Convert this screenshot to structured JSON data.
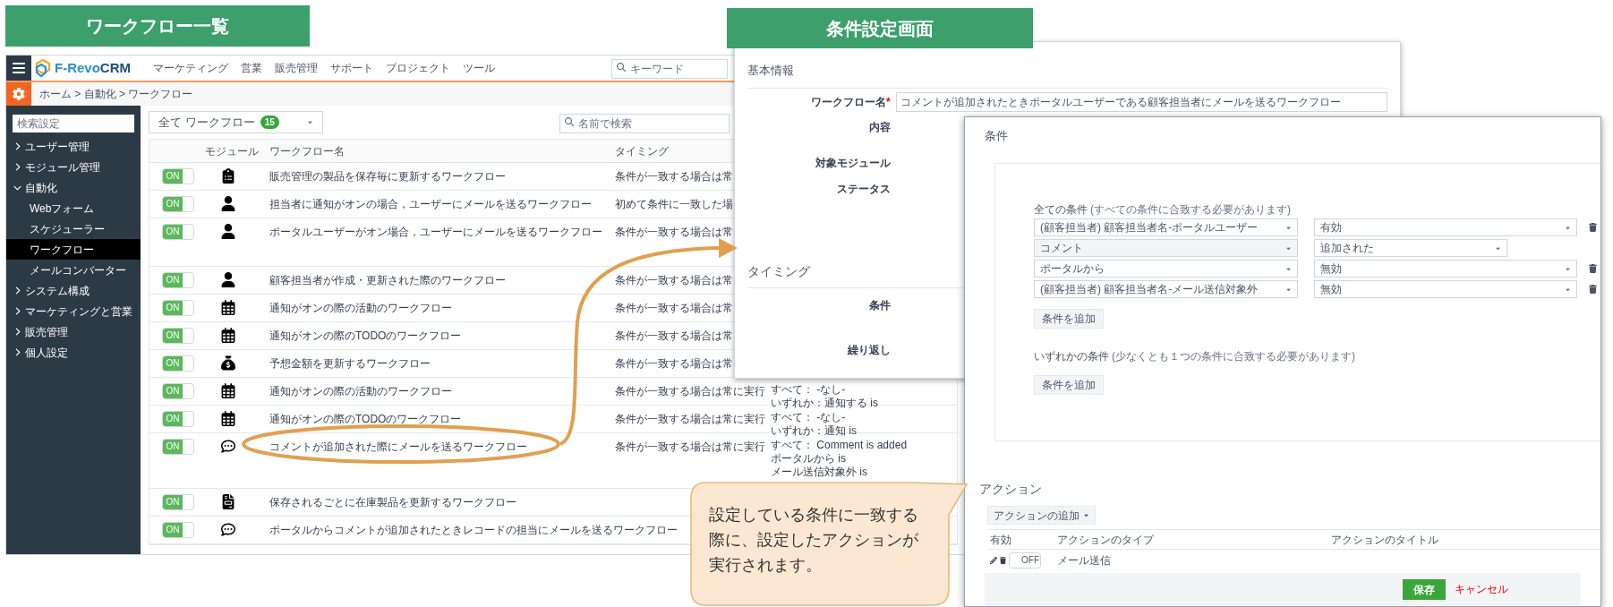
{
  "list_label": "ワークフロー一覧",
  "settings_label": "条件設定画面",
  "list_screen": {
    "logo": {
      "main": "F-Revo",
      "accent": "CRM"
    },
    "nav": [
      "マーケティング",
      "営業",
      "販売管理",
      "サポート",
      "プロジェクト",
      "ツール"
    ],
    "search": {
      "placeholder": "キーワード"
    },
    "breadcrumb": "ホーム > 自動化 > ワークフロー",
    "sidebar": {
      "search": {
        "placeholder": "検索設定"
      },
      "items": [
        {
          "label": "ユーザー管理",
          "expanded": false
        },
        {
          "label": "モジュール管理",
          "expanded": false
        },
        {
          "label": "自動化",
          "expanded": true,
          "children": [
            {
              "label": "Webフォーム",
              "selected": false
            },
            {
              "label": "スケジューラー",
              "selected": false
            },
            {
              "label": "ワークフロー",
              "selected": true
            },
            {
              "label": "メールコンバーター",
              "selected": false
            }
          ]
        },
        {
          "label": "システム構成",
          "expanded": false
        },
        {
          "label": "マーケティングと営業",
          "expanded": false
        },
        {
          "label": "販売管理",
          "expanded": false
        },
        {
          "label": "個人設定",
          "expanded": false
        }
      ]
    },
    "filter": {
      "label": "全て ワークフロー",
      "count": "15"
    },
    "name_search": {
      "placeholder": "名前で検索"
    },
    "table": {
      "columns": [
        "モジュール",
        "ワークフロー名",
        "タイミング"
      ],
      "rows": [
        {
          "on": true,
          "toggle": "ON",
          "kind": "product",
          "name": "販売管理の製品を保存毎に更新するワークフロー",
          "timing": "条件が一致する場合は常"
        },
        {
          "on": true,
          "toggle": "ON",
          "kind": "person",
          "name": "担当者に通知がオンの場合，ユーザーにメールを送るワークフロー",
          "timing": "初めて条件に一致した場"
        },
        {
          "on": true,
          "toggle": "ON",
          "kind": "person",
          "name": "ポータルユーザーがオン場合，ユーザーにメールを送るワークフロー",
          "timing": "条件が一致する場合は常"
        },
        {
          "on": true,
          "toggle": "ON",
          "kind": "person",
          "name": "顧客担当者が作成・更新された際のワークフロー",
          "timing": "条件が一致する場合は常"
        },
        {
          "on": true,
          "toggle": "ON",
          "kind": "calendar",
          "name": "通知がオンの際の活動のワークフロー",
          "timing": "条件が一致する場合は常"
        },
        {
          "on": true,
          "toggle": "ON",
          "kind": "calendar",
          "name": "通知がオンの際のTODOのワークフロー",
          "timing": "条件が一致する場合は常"
        },
        {
          "on": true,
          "toggle": "ON",
          "kind": "money",
          "name": "予想金額を更新するワークフロー",
          "timing": "条件が一致する場合は常"
        },
        {
          "on": true,
          "toggle": "ON",
          "kind": "calendar",
          "name": "通知がオンの際の活動のワークフロー",
          "timing": "条件が一致する場合は常に実行",
          "conditions": [
            "すべて： -なし-",
            "いずれか：通知する is"
          ]
        },
        {
          "on": true,
          "toggle": "ON",
          "kind": "calendar",
          "name": "通知がオンの際のTODOのワークフロー",
          "timing": "条件が一致する場合は常に実行",
          "conditions": [
            "すべて： -なし-",
            "いずれか：通知 is"
          ]
        },
        {
          "on": true,
          "toggle": "ON",
          "kind": "comment",
          "name": "コメントが追加された際にメールを送るワークフロー",
          "timing": "条件が一致する場合は常に実行",
          "conditions": [
            "すべて： Comment is added",
            "ポータルから is",
            "メール送信対象外 is"
          ]
        },
        {
          "on": true,
          "toggle": "ON",
          "kind": "invoice",
          "name": "保存されるごとに在庫製品を更新するワークフロー"
        },
        {
          "on": true,
          "toggle": "ON",
          "kind": "comment",
          "name": "ポータルからコメントが追加されたときレコードの担当にメールを送るワークフロー"
        }
      ]
    }
  },
  "settings_screen": {
    "required_mark": "*",
    "basic_info": {
      "title": "基本情報",
      "fields": [
        {
          "label": "ワークフロー名",
          "required": true,
          "value": "コメントが追加されたときポータルユーザーである顧客担当者にメールを送るワークフロー"
        },
        {
          "label": "内容",
          "required": false
        },
        {
          "label": "対象モジュール",
          "required": false
        },
        {
          "label": "ステータス",
          "required": false
        }
      ]
    },
    "timing": {
      "title": "タイミング",
      "fields": [
        {
          "label": "条件",
          "required": false
        },
        {
          "label": "繰り返し",
          "required": false
        }
      ]
    }
  },
  "conditions_dialog": {
    "title": "条件",
    "all": {
      "title": "全ての条件",
      "note": "(すべての条件に合致する必要があります)",
      "rows": [
        {
          "field": "(顧客担当者) 顧客担当者名-ポータルユーザー",
          "value": "有効",
          "disabled": false,
          "deletable": true
        },
        {
          "field": "コメント",
          "value": "追加された",
          "disabled": true,
          "deletable": false
        },
        {
          "field": "ポータルから",
          "value": "無効",
          "disabled": false,
          "deletable": true
        },
        {
          "field": "(顧客担当者) 顧客担当者名-メール送信対象外",
          "value": "無効",
          "disabled": false,
          "deletable": true
        }
      ],
      "add_button": "条件を追加"
    },
    "any": {
      "title": "いずれかの条件",
      "note": "(少なくとも１つの条件に合致する必要があります)",
      "add_button": "条件を追加"
    },
    "actions": {
      "title": "アクション",
      "add_button": "アクションの追加",
      "columns": [
        "有効",
        "アクションのタイプ",
        "アクションのタイトル"
      ],
      "rows": [
        {
          "on": false,
          "toggle": "OFF",
          "type": "メール送信"
        }
      ]
    },
    "save_button": "保存",
    "cancel_link": "キャンセル"
  },
  "callout": "設定している条件に一致する際に、設定したアクションが実行されます。"
}
